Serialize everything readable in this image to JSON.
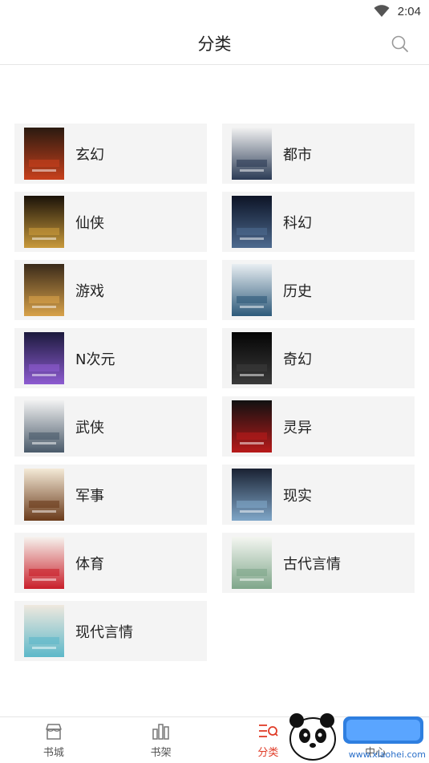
{
  "status": {
    "time": "2:04"
  },
  "header": {
    "title": "分类"
  },
  "categories": [
    {
      "label": "玄幻",
      "cover_colors": [
        "#2a1a10",
        "#c8401c"
      ]
    },
    {
      "label": "都市",
      "cover_colors": [
        "#f2f2f2",
        "#2b3b55"
      ]
    },
    {
      "label": "仙侠",
      "cover_colors": [
        "#1a1209",
        "#c99a3b"
      ]
    },
    {
      "label": "科幻",
      "cover_colors": [
        "#0d1426",
        "#4d6a8f"
      ]
    },
    {
      "label": "游戏",
      "cover_colors": [
        "#3a2a1a",
        "#d8a24a"
      ]
    },
    {
      "label": "历史",
      "cover_colors": [
        "#e8eef2",
        "#2e5a7a"
      ]
    },
    {
      "label": "N次元",
      "cover_colors": [
        "#1c1a3d",
        "#8d5bd1"
      ]
    },
    {
      "label": "奇幻",
      "cover_colors": [
        "#050505",
        "#3a3a3a"
      ]
    },
    {
      "label": "武侠",
      "cover_colors": [
        "#f1f1f1",
        "#4a5a6a"
      ]
    },
    {
      "label": "灵异",
      "cover_colors": [
        "#111111",
        "#b81a1a"
      ]
    },
    {
      "label": "军事",
      "cover_colors": [
        "#f4ead7",
        "#6a3a1a"
      ]
    },
    {
      "label": "现实",
      "cover_colors": [
        "#1a2233",
        "#7fa6c8"
      ]
    },
    {
      "label": "体育",
      "cover_colors": [
        "#f6f3ee",
        "#c91f2a"
      ]
    },
    {
      "label": "古代言情",
      "cover_colors": [
        "#f4f6f1",
        "#7fa68a"
      ]
    },
    {
      "label": "现代言情",
      "cover_colors": [
        "#efe8de",
        "#5db8c9"
      ]
    }
  ],
  "tabbar": {
    "tabs": [
      {
        "label": "书城",
        "active": false
      },
      {
        "label": "书架",
        "active": false
      },
      {
        "label": "分类",
        "active": true
      },
      {
        "label": "中心",
        "active": false
      }
    ]
  },
  "watermark": {
    "text": "www.xiaohei.com"
  },
  "colors": {
    "accent": "#e03c28",
    "card_bg": "#f4f4f4",
    "divider": "#e6e6e6"
  },
  "icons": {
    "search": "search-icon",
    "wifi": "wifi-icon"
  }
}
